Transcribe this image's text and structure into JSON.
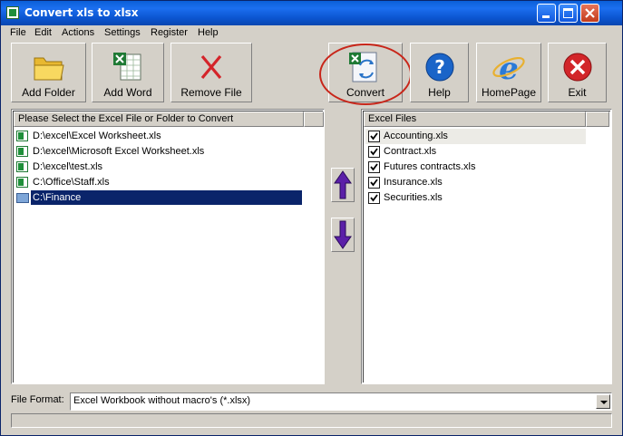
{
  "window": {
    "title": "Convert xls to xlsx"
  },
  "menu": [
    "File",
    "Edit",
    "Actions",
    "Settings",
    "Register",
    "Help"
  ],
  "toolbar": {
    "add_folder": "Add Folder",
    "add_word": "Add Word",
    "remove_file": "Remove File",
    "convert": "Convert",
    "help": "Help",
    "homepage": "HomePage",
    "exit": "Exit"
  },
  "left_panel": {
    "header": "Please Select the Excel File or Folder to Convert",
    "items": [
      {
        "text": "D:\\excel\\Excel Worksheet.xls",
        "icon": "excel-file-icon"
      },
      {
        "text": "D:\\excel\\Microsoft Excel Worksheet.xls",
        "icon": "excel-file-icon"
      },
      {
        "text": "D:\\excel\\test.xls",
        "icon": "excel-file-icon"
      },
      {
        "text": "C:\\Office\\Staff.xls",
        "icon": "excel-file-icon"
      },
      {
        "text": "C:\\Finance",
        "icon": "folder-icon",
        "selected": true
      }
    ]
  },
  "right_panel": {
    "header": "Excel Files",
    "items": [
      {
        "text": "Accounting.xls",
        "checked": true
      },
      {
        "text": "Contract.xls",
        "checked": true
      },
      {
        "text": "Futures contracts.xls",
        "checked": true
      },
      {
        "text": "Insurance.xls",
        "checked": true
      },
      {
        "text": "Securities.xls",
        "checked": true
      }
    ]
  },
  "format": {
    "label": "File Format:",
    "value": "Excel Workbook without macro's (*.xlsx)"
  },
  "colors": {
    "titlebar": "#0a5fd8",
    "selection": "#0a246a",
    "arrow": "#5b1fa8",
    "highlight_ring": "#c8261a"
  }
}
